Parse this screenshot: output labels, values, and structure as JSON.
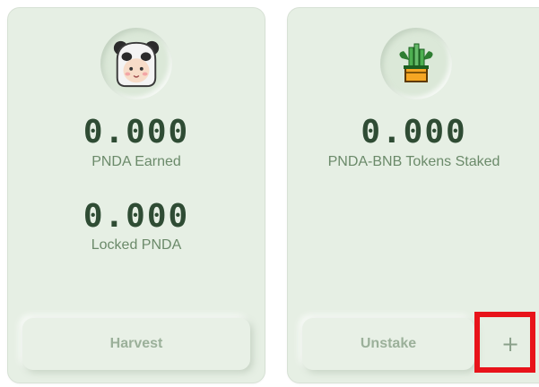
{
  "farm": {
    "earned_value": "0.000",
    "earned_label": "PNDA Earned",
    "locked_value": "0.000",
    "locked_label": "Locked PNDA",
    "harvest_label": "Harvest",
    "avatar_icon": "panda-hood-icon"
  },
  "stake": {
    "staked_value": "0.000",
    "staked_label": "PNDA-BNB Tokens Staked",
    "unstake_label": "Unstake",
    "plus_label": "+",
    "avatar_icon": "bamboo-pot-icon"
  },
  "colors": {
    "card_bg": "#e6efe4",
    "value_text": "#2f4c34",
    "label_text": "#6b8a6a",
    "highlight": "#e8131a"
  }
}
